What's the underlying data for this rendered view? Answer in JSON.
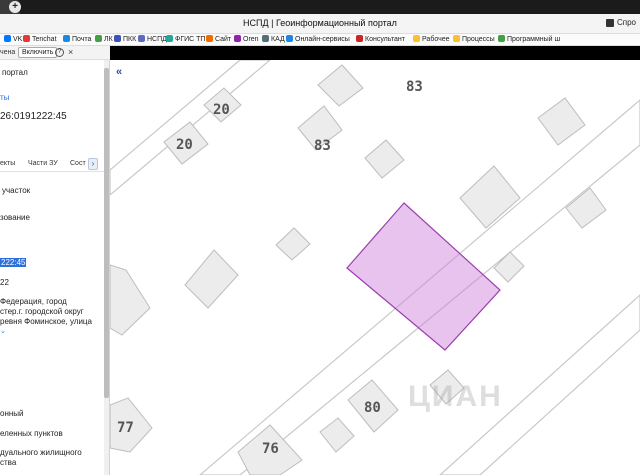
{
  "window": {
    "title": "НСПД | Геоинформационный портал",
    "right_label": "Спро"
  },
  "bookmarks": [
    {
      "label": "VK",
      "color": "#0077ff"
    },
    {
      "label": "Tenchat",
      "color": "#e53935"
    },
    {
      "label": "Почта",
      "color": "#1e88e5"
    },
    {
      "label": "ЛК",
      "color": "#43a047"
    },
    {
      "label": "ПКК",
      "color": "#3f51b5"
    },
    {
      "label": "НСПД",
      "color": "#5c6bc0"
    },
    {
      "label": "ФГИС ТП",
      "color": "#26a69a"
    },
    {
      "label": "Сайт",
      "color": "#ef6c00"
    },
    {
      "label": "Oren",
      "color": "#8e24aa"
    },
    {
      "label": "КАД",
      "color": "#546e7a"
    },
    {
      "label": "Онлайн-сервисы",
      "color": "#1e88e5"
    },
    {
      "label": "Консультант",
      "color": "#c62828"
    },
    {
      "label": "Рабочее",
      "color": "#fbc02d"
    },
    {
      "label": "Процессы",
      "color": "#fbc02d"
    },
    {
      "label": "Программный ш",
      "color": "#43a047"
    }
  ],
  "subbar": {
    "label": "чена",
    "enable_button": "Включить",
    "help": "?",
    "close": "×"
  },
  "side": {
    "portal": "портал",
    "link1": "ты",
    "cadnum": "26:0191222:45",
    "tabs": [
      "екты",
      "Части ЗУ",
      "Сост"
    ],
    "next": "›",
    "type": "участок",
    "use": "зование",
    "selected": "222:45",
    "num22": "22",
    "addr1": "Федерация, город",
    "addr2": "стер.г. городской округ",
    "addr3": "ревня Фоминское, улица",
    "more": "⌄",
    "cat1": "онный",
    "cat2": "еленных пунктов",
    "cat3": "дуального жилищного",
    "cat4": "ства"
  },
  "map": {
    "collapse": "«",
    "watermark": "ЦИАН",
    "labels": [
      "20",
      "20",
      "83",
      "83",
      "80",
      "77",
      "76"
    ],
    "parcel_color": "#c97bd6"
  }
}
